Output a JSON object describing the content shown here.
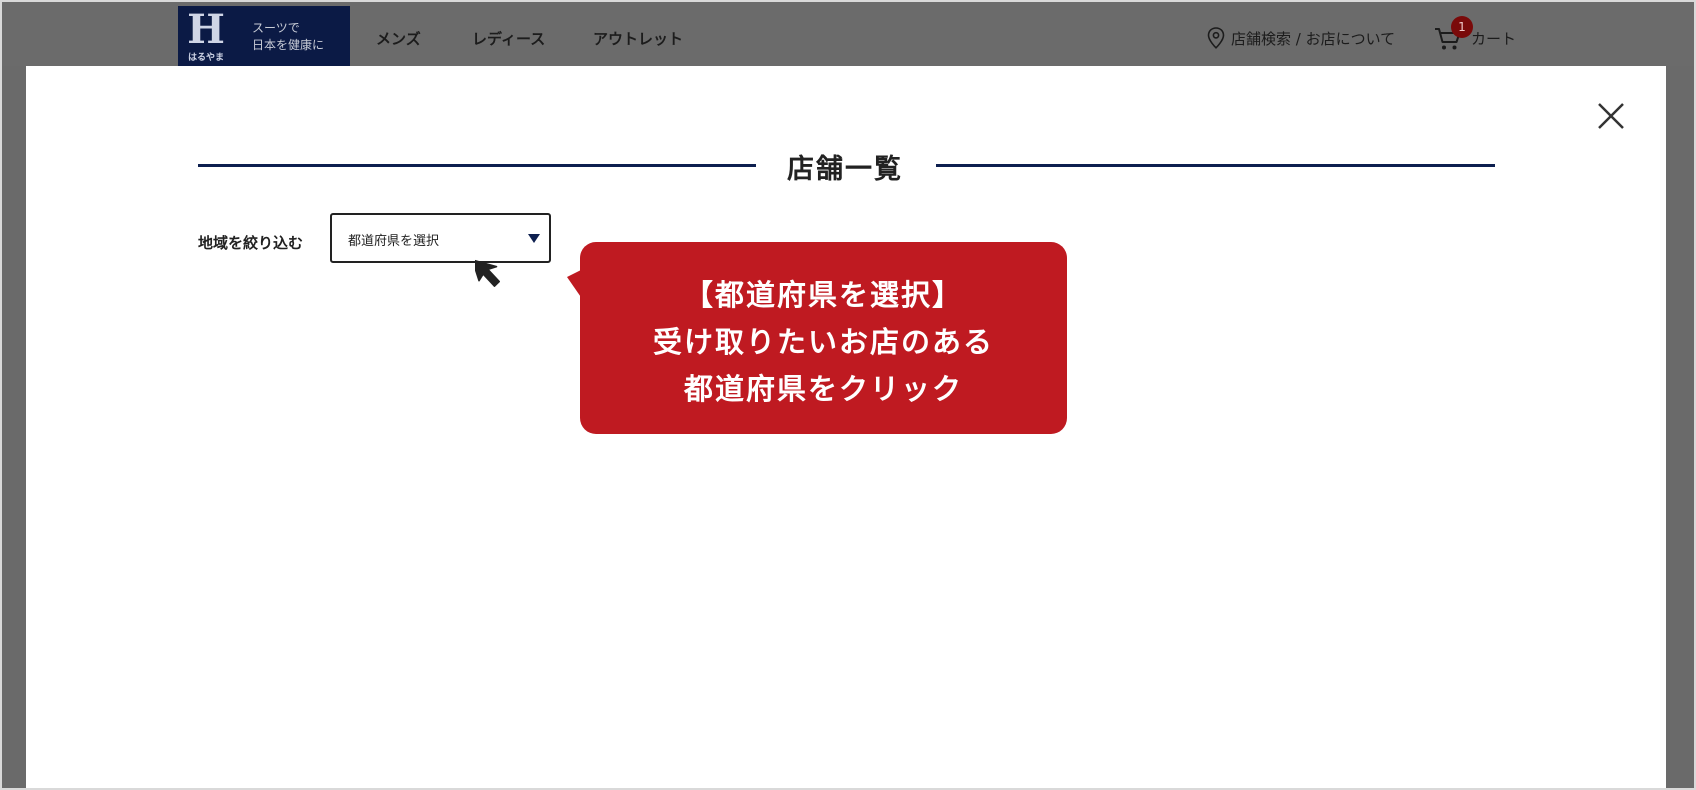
{
  "header": {
    "logo_mark": "H",
    "logo_sub": "はるやま",
    "slogan_line1": "スーツで",
    "slogan_line2": "日本を健康に",
    "nav": [
      "メンズ",
      "レディース",
      "アウトレット"
    ],
    "store_search": "店舗検索 / お店について",
    "cart_label": "カート",
    "cart_count": "1"
  },
  "modal": {
    "title": "店舗一覧",
    "filter_label": "地域を絞り込む",
    "select_value": "都道府県を選択",
    "close_icon": "close-icon"
  },
  "callout": {
    "line1": "【都道府県を選択】",
    "line2": "受け取りたいお店のある",
    "line3": "都道府県をクリック"
  },
  "colors": {
    "brand_navy": "#0d1f4f",
    "callout_red": "#bf1a21",
    "overlay_gray": "#6a6a6a"
  }
}
